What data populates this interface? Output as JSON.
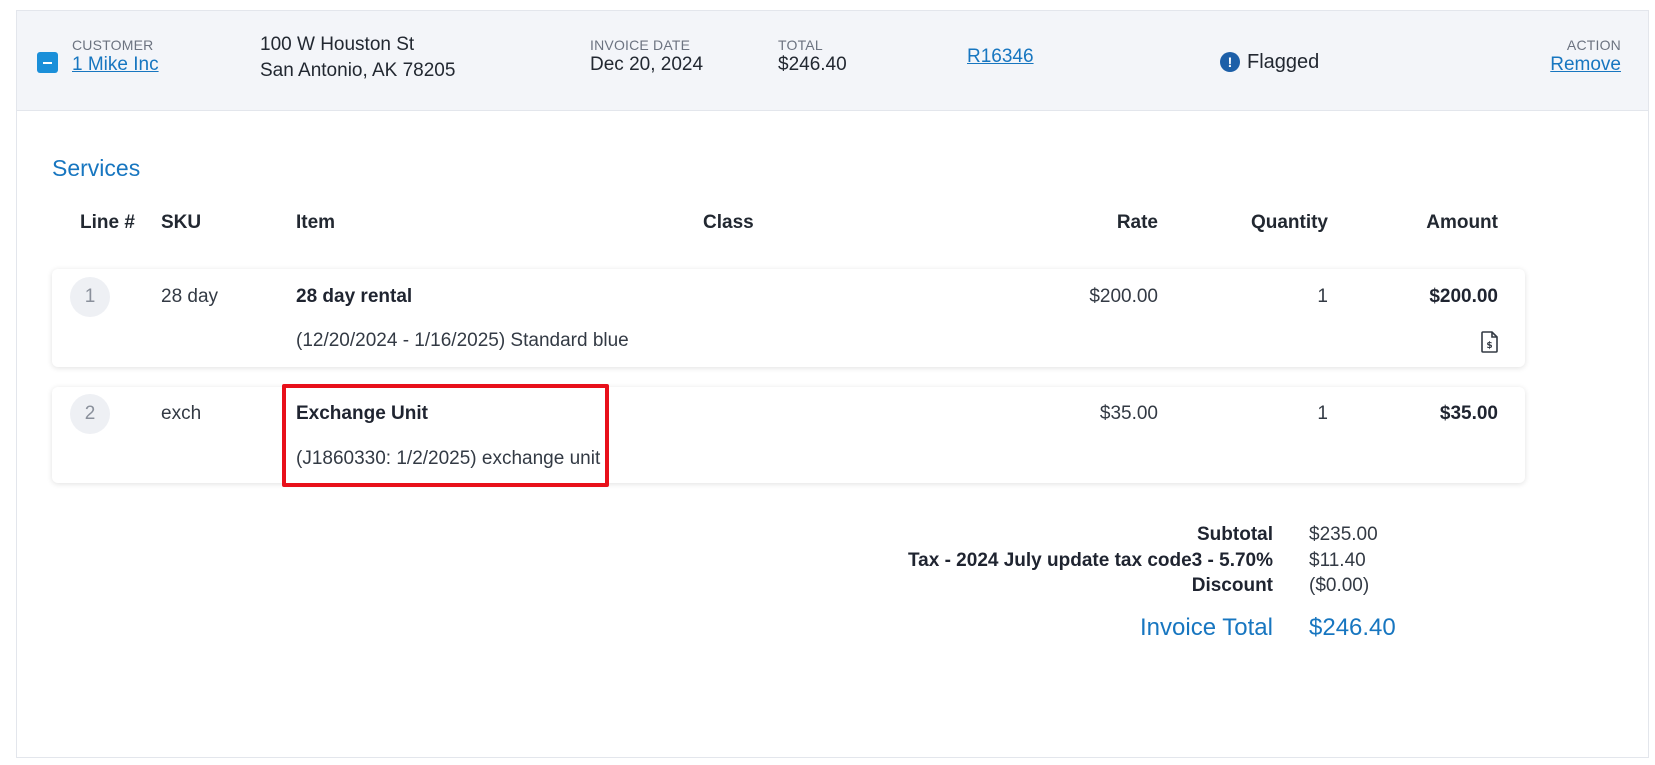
{
  "header": {
    "customer_label": "CUSTOMER",
    "customer_name": "1 Mike Inc",
    "address_line1": "100 W Houston St",
    "address_line2": "San Antonio, AK 78205",
    "invoice_date_label": "INVOICE DATE",
    "invoice_date": "Dec 20, 2024",
    "total_label": "TOTAL",
    "total": "$246.40",
    "invoice_number": "R16346",
    "status": "Flagged",
    "status_icon": "exclamation-circle-icon",
    "action_label": "ACTION",
    "action_link": "Remove"
  },
  "services": {
    "title": "Services",
    "columns": {
      "line": "Line #",
      "sku": "SKU",
      "item": "Item",
      "class": "Class",
      "rate": "Rate",
      "quantity": "Quantity",
      "amount": "Amount"
    },
    "rows": [
      {
        "line": "1",
        "sku": "28 day",
        "item": "28 day rental",
        "description": "(12/20/2024 - 1/16/2025) Standard blue",
        "class": "",
        "rate": "$200.00",
        "quantity": "1",
        "amount": "$200.00",
        "icon": "invoice-dollar-icon"
      },
      {
        "line": "2",
        "sku": "exch",
        "item": "Exchange Unit",
        "description": "(J1860330: 1/2/2025) exchange unit",
        "class": "",
        "rate": "$35.00",
        "quantity": "1",
        "amount": "$35.00"
      }
    ]
  },
  "totals": {
    "subtotal_label": "Subtotal",
    "subtotal": "$235.00",
    "tax_label": "Tax - 2024 July update tax code3 - 5.70%",
    "tax": "$11.40",
    "discount_label": "Discount",
    "discount": "($0.00)",
    "invoice_total_label": "Invoice Total",
    "invoice_total": "$246.40"
  },
  "colors": {
    "accent": "#1776c0",
    "highlight": "#e8101a",
    "header_bg": "#f3f5f9"
  }
}
